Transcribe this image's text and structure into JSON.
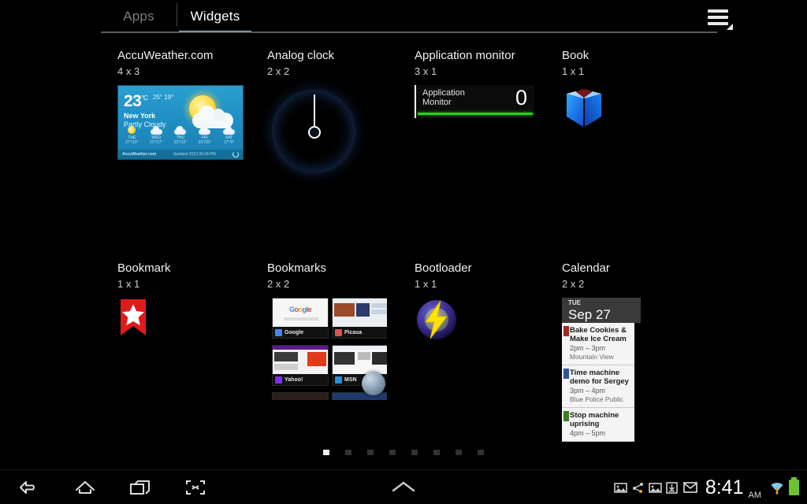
{
  "tabs": [
    {
      "label": "Apps",
      "active": false
    },
    {
      "label": "Widgets",
      "active": true
    }
  ],
  "menu": {
    "icon": "hamburger-menu-icon"
  },
  "widgets": [
    {
      "title": "AccuWeather.com",
      "size": "4 x 3",
      "preview": {
        "type": "weather",
        "temperature": "23",
        "unit": "°C",
        "high_low": "25° 19°",
        "city": "New York",
        "condition": "Partly Cloudy",
        "brand": "AccuWeather.com",
        "updated": "Updated 2013 06:18 PM",
        "forecast": [
          {
            "day": "TUE",
            "temps": "27°/19°"
          },
          {
            "day": "WED",
            "temps": "21°/17°"
          },
          {
            "day": "THU",
            "temps": "22°/15°"
          },
          {
            "day": "FRI",
            "temps": "23°/15°"
          },
          {
            "day": "SAT",
            "temps": "17°/9°"
          }
        ]
      }
    },
    {
      "title": "Analog clock",
      "size": "2 x 2",
      "preview": {
        "type": "analog-clock"
      }
    },
    {
      "title": "Application monitor",
      "size": "3 x 1",
      "preview": {
        "type": "app-monitor",
        "label_line1": "Application",
        "label_line2": "Monitor",
        "value": "0",
        "bar_color": "#2bd21a"
      }
    },
    {
      "title": "Book",
      "size": "1 x 1",
      "preview": {
        "type": "book-icon",
        "color": "#1d7ff0"
      }
    },
    {
      "title": "Bookmark",
      "size": "1 x 1",
      "preview": {
        "type": "bookmark-ribbon",
        "color": "#e01b1b"
      }
    },
    {
      "title": "Bookmarks",
      "size": "2 x 2",
      "preview": {
        "type": "bookmarks-grid",
        "items": [
          {
            "name": "Google",
            "fav_color": "#4285f4"
          },
          {
            "name": "Picasa",
            "fav_color": "#d9534f"
          },
          {
            "name": "Yahoo!",
            "fav_color": "#7b2ff7"
          },
          {
            "name": "MSN",
            "fav_color": "#2b8fd9"
          }
        ]
      }
    },
    {
      "title": "Bootloader",
      "size": "1 x 1",
      "preview": {
        "type": "bootloader-icon",
        "bolt_color": "#ffe400",
        "disc_color": "#3b2c8f"
      }
    },
    {
      "title": "Calendar",
      "size": "2 x 2",
      "preview": {
        "type": "calendar",
        "day_of_week": "TUE",
        "date": "Sep 27",
        "events": [
          {
            "title_line1": "Bake Cookies &",
            "title_line2": "Make Ice Cream",
            "time": "2pm – 3pm",
            "location": "Mountain View",
            "color": "#9c2b2b"
          },
          {
            "title_line1": "Time machine",
            "title_line2": "demo for Sergey",
            "time": "3pm – 4pm",
            "location": "Blue Police Public",
            "color": "#33559b"
          },
          {
            "title_line1": "Stop machine",
            "title_line2": "uprising",
            "time": "4pm – 5pm",
            "location": "",
            "color": "#3a7d23"
          }
        ]
      }
    }
  ],
  "pager": {
    "count": 8,
    "active_index": 0
  },
  "system_bar": {
    "nav": [
      {
        "icon": "back-icon"
      },
      {
        "icon": "home-icon"
      },
      {
        "icon": "recent-apps-icon"
      },
      {
        "icon": "screenshot-icon"
      }
    ],
    "up_chevron": {
      "icon": "chevron-up-icon"
    },
    "status_icons": [
      {
        "icon": "image-icon"
      },
      {
        "icon": "share-icon"
      },
      {
        "icon": "image-icon"
      },
      {
        "icon": "download-icon"
      },
      {
        "icon": "mail-icon"
      }
    ],
    "time": "8:41",
    "meridiem": "AM",
    "wifi": {
      "icon": "wifi-icon"
    },
    "battery": {
      "icon": "battery-full-icon",
      "color": "#6ec22e"
    }
  }
}
